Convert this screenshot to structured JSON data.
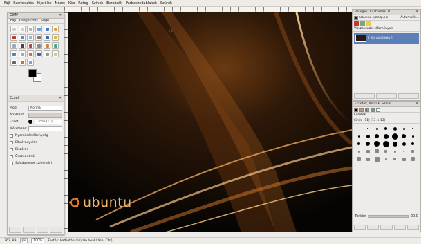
{
  "menu": [
    "Fájl",
    "Szerkesztés",
    "Kijelölés",
    "Nézet",
    "Kép",
    "Réteg",
    "Színek",
    "Eszközök",
    "Párbeszédablakok",
    "Szűrők"
  ],
  "toolbox": {
    "title": "GIMP",
    "menu": [
      "Fájl",
      "Kiterjesztés",
      "Súgó"
    ],
    "tool_colors": [
      "#cfcfcf",
      "#cfcfcf",
      "#b3b3b3",
      "#6aa0d8",
      "#3d7cc9",
      "#e0a23a",
      "#c0392b",
      "#5d8cc4",
      "#8fb5df",
      "#777",
      "#2d6bb5",
      "#d8b54a",
      "#9ab",
      "#444",
      "#b44",
      "#888",
      "#c84",
      "#4a8",
      "#48c",
      "#aaa",
      "#e55",
      "#36a",
      "#7a7",
      "#cc8",
      "#666",
      "#b73",
      "#89c"
    ],
    "dock_title": "Ecset",
    "options": {
      "mode_label": "Mód:",
      "mode_value": "Normál",
      "opacity_label": "Átlátszatl.:",
      "brush_label": "Ecset:",
      "brush_value": "Circle (11)",
      "scale_label": "Méretezés:",
      "checks": [
        "Nyomásérzékenység",
        "Elhalványulás",
        "Elszórás",
        "Összeadódó",
        "Színátmenet színének h"
      ]
    }
  },
  "layers_dock": {
    "title": "Rétegek, Csatornák, U",
    "image_select": "Ubuntu...(Wallp.) 1",
    "auto": "Automatik...",
    "preview_label": "Visszavonási előzmények",
    "layer_name": "[ Kiinduló kép ]"
  },
  "brushes_dock": {
    "title": "Ecsetek, Minták, Színát",
    "section": "Ecsetek",
    "brush_name": "Circle (11) (13 × 13)",
    "spacing_label": "Térköz",
    "spacing_value": "20.0"
  },
  "canvas": {
    "logo_text": "ubuntu"
  },
  "status": {
    "coords": "362, 83",
    "unit": "px",
    "zoom": "100%",
    "message": "Festés: kattintással (szín beállítása: Ctrl)"
  }
}
